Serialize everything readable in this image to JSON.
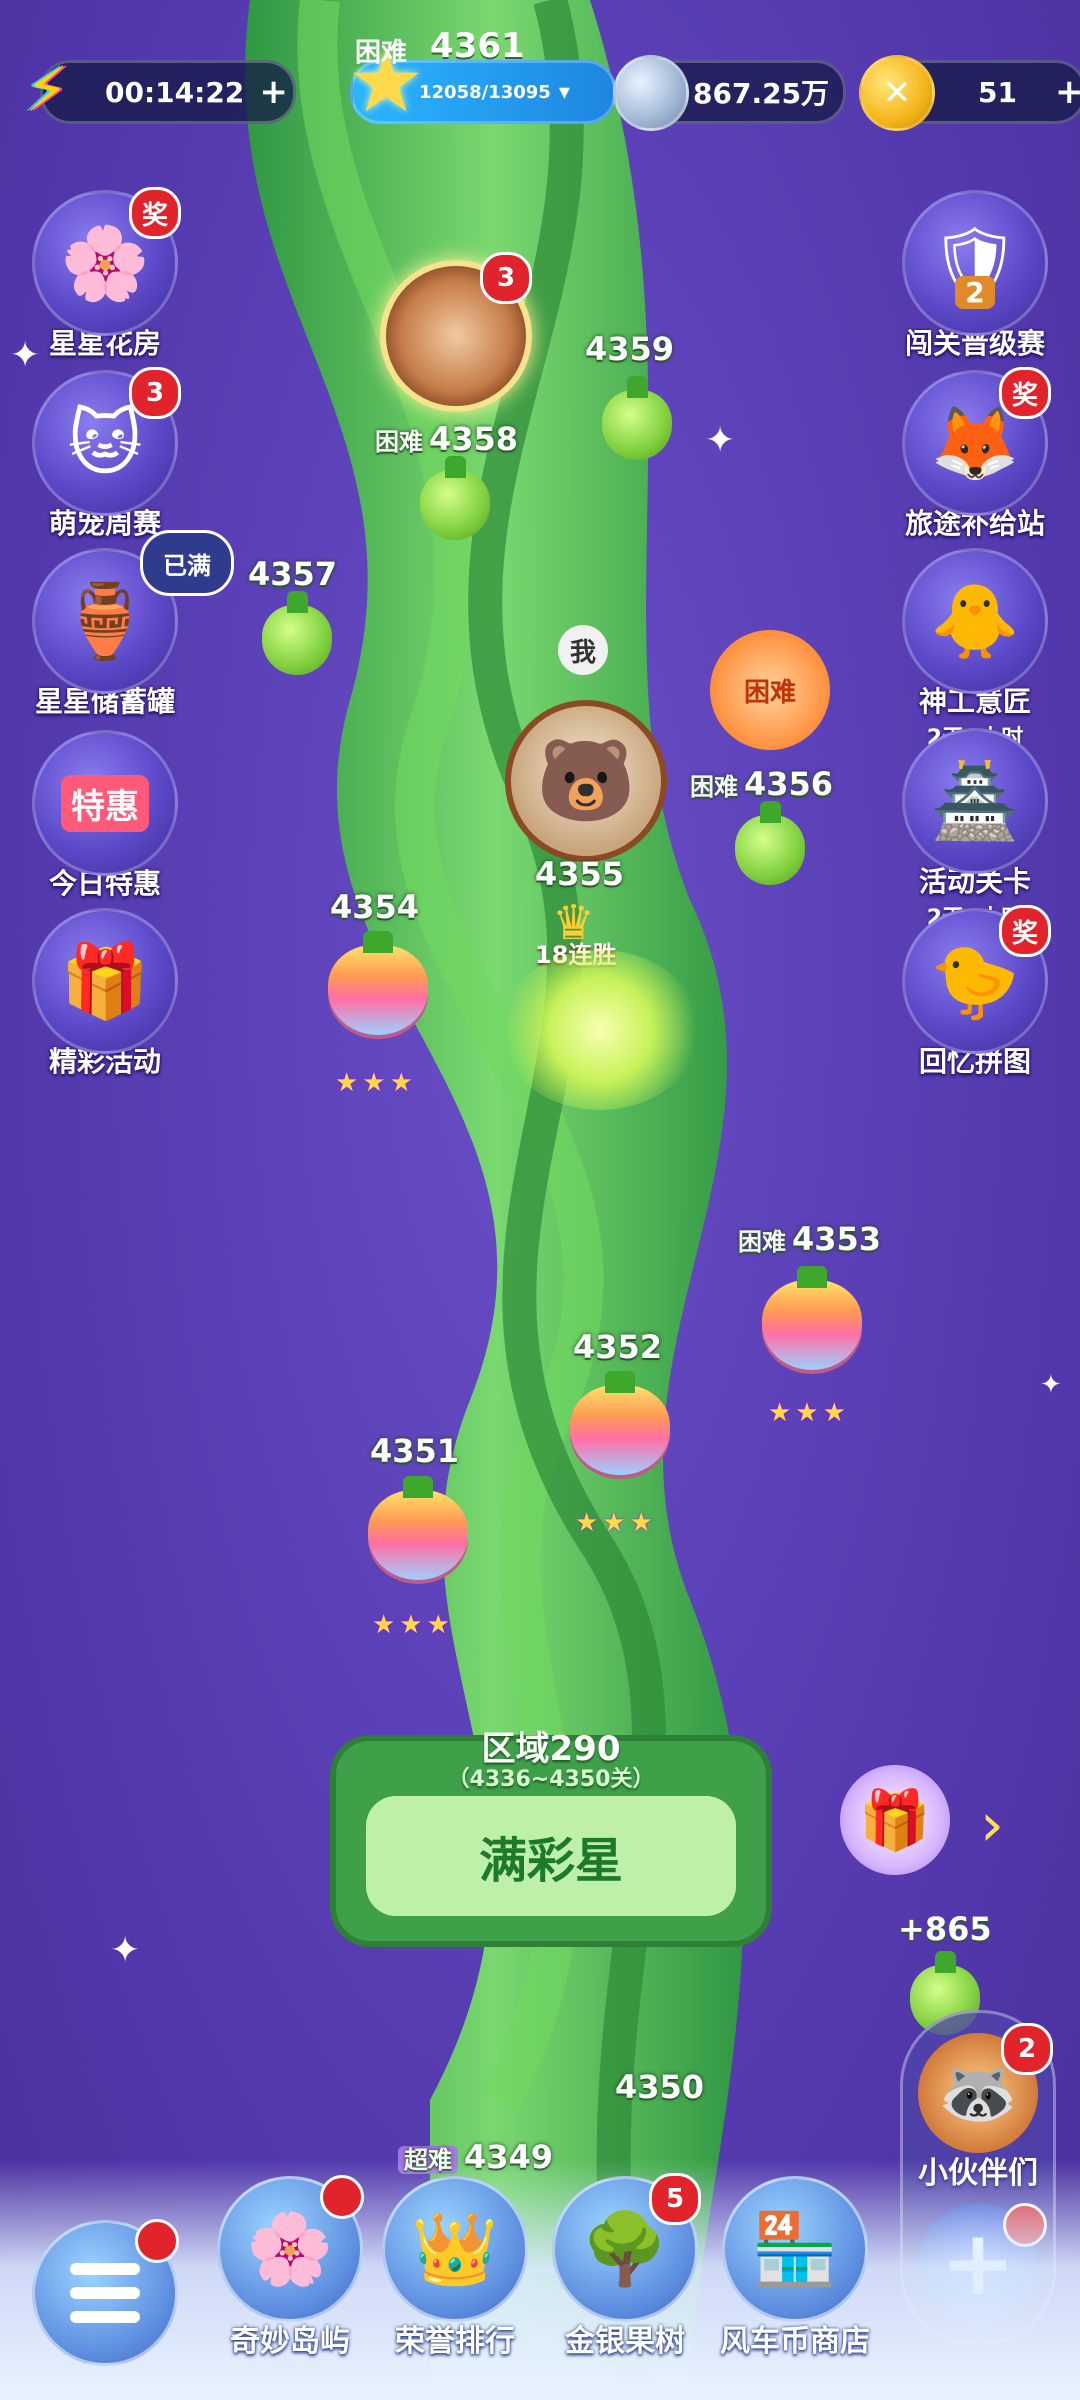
{
  "top": {
    "energy_timer": "00:14:22",
    "energy_plus": "+",
    "star_progress": "12058/13095",
    "silver_amount": "867.25万",
    "coin_amount": "51",
    "coin_plus": "+",
    "top_level_tag": "困难",
    "top_level": "4361"
  },
  "left_menu": [
    {
      "label": "星星花房",
      "badge": "奖",
      "icon": "flower-house-icon"
    },
    {
      "label": "萌宠周赛",
      "badge": "3",
      "icon": "cat-icon"
    },
    {
      "label": "星星储蓄罐",
      "badge": "已满",
      "icon": "star-jar-icon"
    },
    {
      "label": "今日特惠",
      "badge": "",
      "icon": "special-offer-icon",
      "inner_text": "特惠"
    },
    {
      "label": "精彩活动",
      "badge": "",
      "icon": "gift-boxes-icon"
    }
  ],
  "right_menu": [
    {
      "label": "闯关晋级赛",
      "sub": "",
      "badge": "",
      "icon": "rank-badge-icon",
      "inner_text": "2"
    },
    {
      "label": "旅途补给站",
      "sub": "",
      "badge": "奖",
      "icon": "fox-gift-icon"
    },
    {
      "label": "神工意匠",
      "sub": "2天8小时",
      "badge": "",
      "icon": "craft-icon"
    },
    {
      "label": "活动关卡",
      "sub": "2天8小时",
      "badge": "",
      "icon": "pagoda-icon"
    },
    {
      "label": "回忆拼图",
      "sub": "",
      "badge": "奖",
      "icon": "puzzle-chick-icon"
    }
  ],
  "map": {
    "wheel_badge": "3",
    "me_label": "我",
    "hard_flower_label": "困难",
    "streak_label": "18连胜",
    "levels": [
      {
        "num": "4359",
        "tag": ""
      },
      {
        "num": "4358",
        "tag": "困难"
      },
      {
        "num": "4357",
        "tag": ""
      },
      {
        "num": "4356",
        "tag": "困难"
      },
      {
        "num": "4355",
        "tag": ""
      },
      {
        "num": "4354",
        "tag": "",
        "stars": "★★★"
      },
      {
        "num": "4353",
        "tag": "困难",
        "stars": "★★★"
      },
      {
        "num": "4352",
        "tag": "",
        "stars": "★★★"
      },
      {
        "num": "4351",
        "tag": "",
        "stars": "★★★"
      },
      {
        "num": "4350",
        "tag": ""
      },
      {
        "num": "4349",
        "tag": "超难"
      }
    ],
    "region": {
      "title": "区域290",
      "range": "（4336~4350关）",
      "mode": "满彩星"
    },
    "gift_amount": "+865"
  },
  "partners": {
    "label": "小伙伴们",
    "badge": "2",
    "plus": "+"
  },
  "bottom_nav": [
    {
      "label": "",
      "icon": "menu-icon",
      "dot": true
    },
    {
      "label": "奇妙岛屿",
      "icon": "island-tree-icon",
      "dot": true
    },
    {
      "label": "荣誉排行",
      "icon": "crown-icon",
      "dot": false
    },
    {
      "label": "金银果树",
      "icon": "fruit-tree-icon",
      "badge": "5"
    },
    {
      "label": "风车币商店",
      "icon": "shop-icon",
      "dot": false
    }
  ],
  "colors": {
    "background": "#5a3fb6",
    "stalk": "#3fb44a",
    "badge_red": "#e1232c",
    "gold": "#ffd94a"
  }
}
